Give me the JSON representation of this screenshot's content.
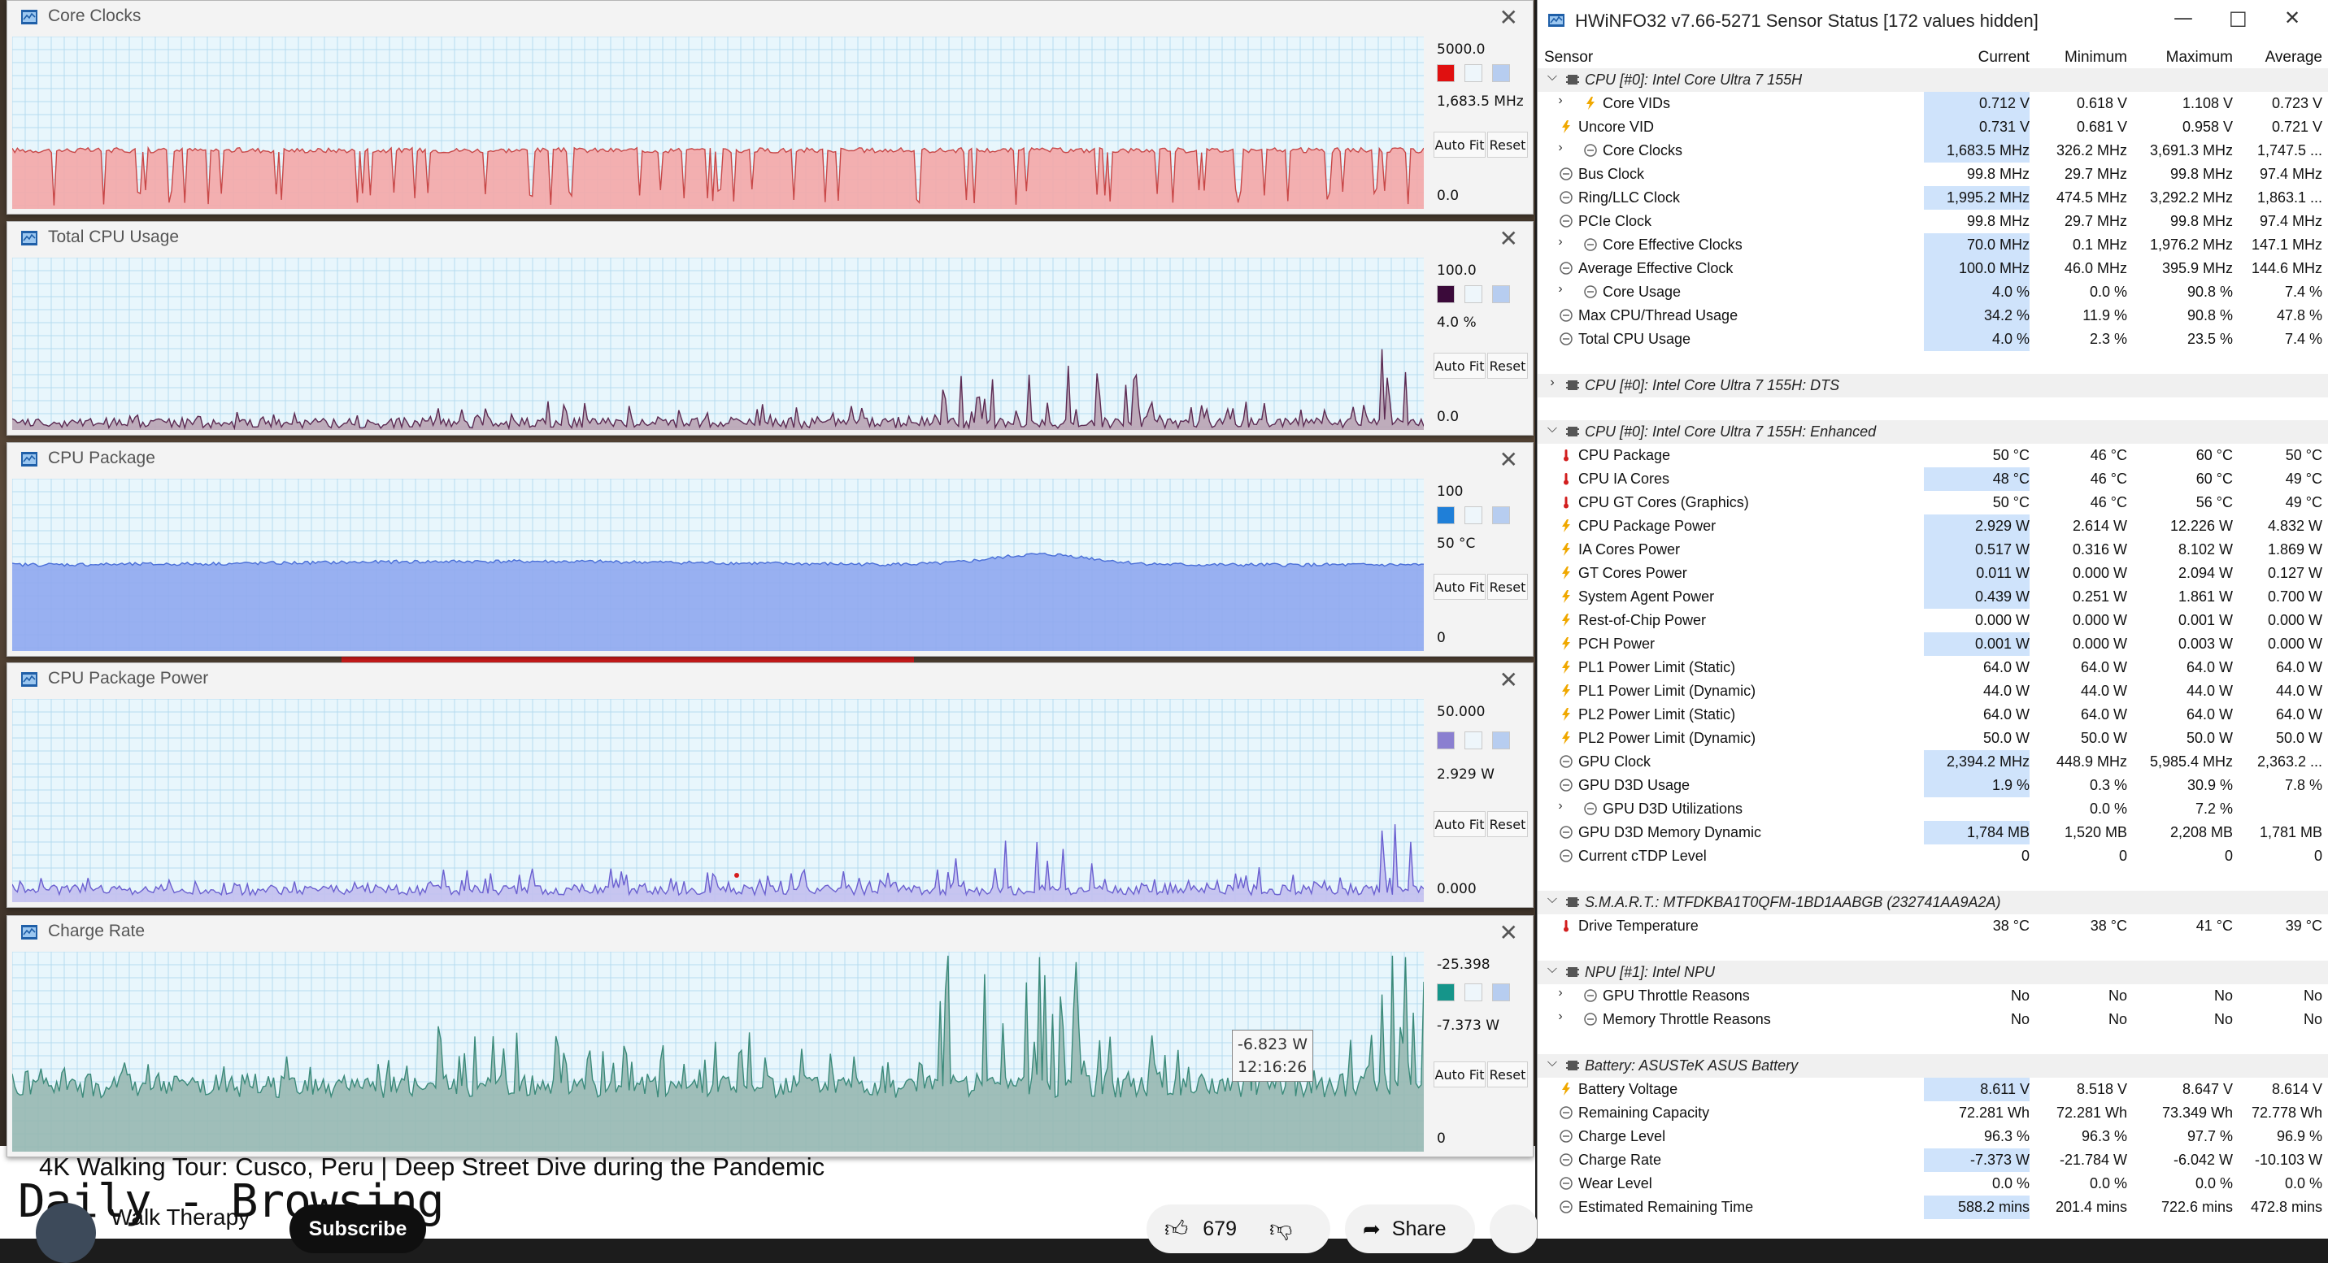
{
  "youtube": {
    "title": "4K Walking Tour: Cusco, Peru | Deep Street Dive during the Pandemic",
    "overlay_text": "Daily - Browsing",
    "channel": "Walk Therapy",
    "subscribe_label": "Subscribe",
    "likes": "679",
    "share_label": "Share"
  },
  "graphs": [
    {
      "title": "Core Clocks",
      "max": "5000.0",
      "current": "1,683.5 MHz",
      "min": "0.0",
      "color": "#f4a7a7",
      "line": "#c84747",
      "swatch": "#e01010",
      "level": 0.34,
      "noise": 0.015,
      "spikes": "down"
    },
    {
      "title": "Total CPU Usage",
      "max": "100.0",
      "current": "4.0 %",
      "min": "0.0",
      "color": "#b9a4b4",
      "line": "#5c2a52",
      "swatch": "#3b0a3a",
      "level": 0.04,
      "noise": 0.03,
      "spikes": "up"
    },
    {
      "title": "CPU Package",
      "max": "100",
      "current": "50 °C",
      "min": "0",
      "color": "#8fa9ef",
      "line": "#4a6fd8",
      "swatch": "#1f7fd8",
      "level": 0.5,
      "noise": 0.01,
      "spikes": "hump"
    },
    {
      "title": "CPU Package Power",
      "max": "50.000",
      "current": "2.929 W",
      "min": "0.000",
      "color": "#c3c0ee",
      "line": "#6a5fd0",
      "swatch": "#8a7fd0",
      "level": 0.06,
      "noise": 0.025,
      "spikes": "up"
    },
    {
      "title": "Charge Rate",
      "max": "-25.398",
      "current": "-7.373 W",
      "min": "0",
      "color": "#97b8b1",
      "line": "#3b8a7a",
      "swatch": "#15958a",
      "level": 0.33,
      "noise": 0.06,
      "spikes": "up"
    }
  ],
  "graph_buttons": {
    "auto_fit": "Auto Fit",
    "reset": "Reset"
  },
  "tooltip": {
    "value": "-6.823 W",
    "time": "12:16:26"
  },
  "sensor": {
    "title": "HWiNFO32 v7.66-5271 Sensor Status [172 values hidden]",
    "columns": [
      "Sensor",
      "Current",
      "Minimum",
      "Maximum",
      "Average"
    ],
    "rows": [
      {
        "type": "group",
        "name": "CPU [#0]: Intel Core Ultra 7 155H",
        "expanded": true
      },
      {
        "type": "row",
        "exp": ">",
        "icon": "bolt",
        "name": "Core VIDs",
        "cur": "0.712 V",
        "min": "0.618 V",
        "max": "1.108 V",
        "avg": "0.723 V",
        "hl": true,
        "indent": 2
      },
      {
        "type": "row",
        "icon": "bolt",
        "name": "Uncore VID",
        "cur": "0.731 V",
        "min": "0.681 V",
        "max": "0.958 V",
        "avg": "0.721 V",
        "hl": true,
        "indent": 1
      },
      {
        "type": "row",
        "exp": ">",
        "icon": "clock",
        "name": "Core Clocks",
        "cur": "1,683.5 MHz",
        "min": "326.2 MHz",
        "max": "3,691.3 MHz",
        "avg": "1,747.5 ...",
        "hl": true,
        "indent": 2
      },
      {
        "type": "row",
        "icon": "clock",
        "name": "Bus Clock",
        "cur": "99.8 MHz",
        "min": "29.7 MHz",
        "max": "99.8 MHz",
        "avg": "97.4 MHz",
        "hl": false,
        "indent": 1
      },
      {
        "type": "row",
        "icon": "clock",
        "name": "Ring/LLC Clock",
        "cur": "1,995.2 MHz",
        "min": "474.5 MHz",
        "max": "3,292.2 MHz",
        "avg": "1,863.1 ...",
        "hl": true,
        "indent": 1
      },
      {
        "type": "row",
        "icon": "clock",
        "name": "PCIe Clock",
        "cur": "99.8 MHz",
        "min": "29.7 MHz",
        "max": "99.8 MHz",
        "avg": "97.4 MHz",
        "hl": false,
        "indent": 1
      },
      {
        "type": "row",
        "exp": ">",
        "icon": "clock",
        "name": "Core Effective Clocks",
        "cur": "70.0 MHz",
        "min": "0.1 MHz",
        "max": "1,976.2 MHz",
        "avg": "147.1 MHz",
        "hl": true,
        "indent": 2
      },
      {
        "type": "row",
        "icon": "clock",
        "name": "Average Effective Clock",
        "cur": "100.0 MHz",
        "min": "46.0 MHz",
        "max": "395.9 MHz",
        "avg": "144.6 MHz",
        "hl": true,
        "indent": 1
      },
      {
        "type": "row",
        "exp": ">",
        "icon": "clock",
        "name": "Core Usage",
        "cur": "4.0 %",
        "min": "0.0 %",
        "max": "90.8 %",
        "avg": "7.4 %",
        "hl": true,
        "indent": 2
      },
      {
        "type": "row",
        "icon": "clock",
        "name": "Max CPU/Thread Usage",
        "cur": "34.2 %",
        "min": "11.9 %",
        "max": "90.8 %",
        "avg": "47.8 %",
        "hl": true,
        "indent": 1
      },
      {
        "type": "row",
        "icon": "clock",
        "name": "Total CPU Usage",
        "cur": "4.0 %",
        "min": "2.3 %",
        "max": "23.5 %",
        "avg": "7.4 %",
        "hl": true,
        "indent": 1
      },
      {
        "type": "sep"
      },
      {
        "type": "group",
        "name": "CPU [#0]: Intel Core Ultra 7 155H: DTS",
        "expanded": false
      },
      {
        "type": "sep"
      },
      {
        "type": "group",
        "name": "CPU [#0]: Intel Core Ultra 7 155H: Enhanced",
        "expanded": true
      },
      {
        "type": "row",
        "icon": "temp",
        "name": "CPU Package",
        "cur": "50 °C",
        "min": "46 °C",
        "max": "60 °C",
        "avg": "50 °C",
        "hl": false,
        "indent": 1
      },
      {
        "type": "row",
        "icon": "temp",
        "name": "CPU IA Cores",
        "cur": "48 °C",
        "min": "46 °C",
        "max": "60 °C",
        "avg": "49 °C",
        "hl": true,
        "indent": 1
      },
      {
        "type": "row",
        "icon": "temp",
        "name": "CPU GT Cores (Graphics)",
        "cur": "50 °C",
        "min": "46 °C",
        "max": "56 °C",
        "avg": "49 °C",
        "hl": false,
        "indent": 1
      },
      {
        "type": "row",
        "icon": "bolt",
        "name": "CPU Package Power",
        "cur": "2.929 W",
        "min": "2.614 W",
        "max": "12.226 W",
        "avg": "4.832 W",
        "hl": true,
        "indent": 1
      },
      {
        "type": "row",
        "icon": "bolt",
        "name": "IA Cores Power",
        "cur": "0.517 W",
        "min": "0.316 W",
        "max": "8.102 W",
        "avg": "1.869 W",
        "hl": true,
        "indent": 1
      },
      {
        "type": "row",
        "icon": "bolt",
        "name": "GT Cores Power",
        "cur": "0.011 W",
        "min": "0.000 W",
        "max": "2.094 W",
        "avg": "0.127 W",
        "hl": true,
        "indent": 1
      },
      {
        "type": "row",
        "icon": "bolt",
        "name": "System Agent Power",
        "cur": "0.439 W",
        "min": "0.251 W",
        "max": "1.861 W",
        "avg": "0.700 W",
        "hl": true,
        "indent": 1
      },
      {
        "type": "row",
        "icon": "bolt",
        "name": "Rest-of-Chip Power",
        "cur": "0.000 W",
        "min": "0.000 W",
        "max": "0.001 W",
        "avg": "0.000 W",
        "hl": false,
        "indent": 1
      },
      {
        "type": "row",
        "icon": "bolt",
        "name": "PCH Power",
        "cur": "0.001 W",
        "min": "0.000 W",
        "max": "0.003 W",
        "avg": "0.000 W",
        "hl": true,
        "indent": 1
      },
      {
        "type": "row",
        "icon": "bolt",
        "name": "PL1 Power Limit (Static)",
        "cur": "64.0 W",
        "min": "64.0 W",
        "max": "64.0 W",
        "avg": "64.0 W",
        "hl": false,
        "indent": 1
      },
      {
        "type": "row",
        "icon": "bolt",
        "name": "PL1 Power Limit (Dynamic)",
        "cur": "44.0 W",
        "min": "44.0 W",
        "max": "44.0 W",
        "avg": "44.0 W",
        "hl": false,
        "indent": 1
      },
      {
        "type": "row",
        "icon": "bolt",
        "name": "PL2 Power Limit (Static)",
        "cur": "64.0 W",
        "min": "64.0 W",
        "max": "64.0 W",
        "avg": "64.0 W",
        "hl": false,
        "indent": 1
      },
      {
        "type": "row",
        "icon": "bolt",
        "name": "PL2 Power Limit (Dynamic)",
        "cur": "50.0 W",
        "min": "50.0 W",
        "max": "50.0 W",
        "avg": "50.0 W",
        "hl": false,
        "indent": 1
      },
      {
        "type": "row",
        "icon": "clock",
        "name": "GPU Clock",
        "cur": "2,394.2 MHz",
        "min": "448.9 MHz",
        "max": "5,985.4 MHz",
        "avg": "2,363.2 ...",
        "hl": true,
        "indent": 1
      },
      {
        "type": "row",
        "icon": "clock",
        "name": "GPU D3D Usage",
        "cur": "1.9 %",
        "min": "0.3 %",
        "max": "30.9 %",
        "avg": "7.8 %",
        "hl": true,
        "indent": 1
      },
      {
        "type": "row",
        "exp": ">",
        "icon": "clock",
        "name": "GPU D3D Utilizations",
        "cur": "",
        "min": "0.0 %",
        "max": "7.2 %",
        "avg": "",
        "hl": false,
        "indent": 2
      },
      {
        "type": "row",
        "icon": "clock",
        "name": "GPU D3D Memory Dynamic",
        "cur": "1,784 MB",
        "min": "1,520 MB",
        "max": "2,208 MB",
        "avg": "1,781 MB",
        "hl": true,
        "indent": 1
      },
      {
        "type": "row",
        "icon": "clock",
        "name": "Current cTDP Level",
        "cur": "0",
        "min": "0",
        "max": "0",
        "avg": "0",
        "hl": false,
        "indent": 1
      },
      {
        "type": "sep"
      },
      {
        "type": "group",
        "name": "S.M.A.R.T.: MTFDKBA1T0QFM-1BD1AABGB (232741AA9A2A)",
        "expanded": true
      },
      {
        "type": "row",
        "icon": "temp",
        "name": "Drive Temperature",
        "cur": "38 °C",
        "min": "38 °C",
        "max": "41 °C",
        "avg": "39 °C",
        "hl": false,
        "indent": 1
      },
      {
        "type": "sep"
      },
      {
        "type": "group",
        "name": "NPU [#1]: Intel NPU",
        "expanded": true
      },
      {
        "type": "row",
        "exp": ">",
        "icon": "clock",
        "name": "GPU Throttle Reasons",
        "cur": "No",
        "min": "No",
        "max": "No",
        "avg": "No",
        "hl": false,
        "indent": 2
      },
      {
        "type": "row",
        "exp": ">",
        "icon": "clock",
        "name": "Memory Throttle Reasons",
        "cur": "No",
        "min": "No",
        "max": "No",
        "avg": "No",
        "hl": false,
        "indent": 2
      },
      {
        "type": "sep"
      },
      {
        "type": "group",
        "name": "Battery: ASUSTeK ASUS Battery",
        "expanded": true
      },
      {
        "type": "row",
        "icon": "bolt",
        "name": "Battery Voltage",
        "cur": "8.611 V",
        "min": "8.518 V",
        "max": "8.647 V",
        "avg": "8.614 V",
        "hl": true,
        "indent": 1
      },
      {
        "type": "row",
        "icon": "clock",
        "name": "Remaining Capacity",
        "cur": "72.281 Wh",
        "min": "72.281 Wh",
        "max": "73.349 Wh",
        "avg": "72.778 Wh",
        "hl": false,
        "indent": 1
      },
      {
        "type": "row",
        "icon": "clock",
        "name": "Charge Level",
        "cur": "96.3 %",
        "min": "96.3 %",
        "max": "97.7 %",
        "avg": "96.9 %",
        "hl": false,
        "indent": 1
      },
      {
        "type": "row",
        "icon": "clock",
        "name": "Charge Rate",
        "cur": "-7.373 W",
        "min": "-21.784 W",
        "max": "-6.042 W",
        "avg": "-10.103 W",
        "hl": true,
        "indent": 1
      },
      {
        "type": "row",
        "icon": "clock",
        "name": "Wear Level",
        "cur": "0.0 %",
        "min": "0.0 %",
        "max": "0.0 %",
        "avg": "0.0 %",
        "hl": false,
        "indent": 1
      },
      {
        "type": "row",
        "icon": "clock",
        "name": "Estimated Remaining Time",
        "cur": "588.2 mins",
        "min": "201.4 mins",
        "max": "722.6 mins",
        "avg": "472.8 mins",
        "hl": true,
        "indent": 1
      }
    ]
  }
}
